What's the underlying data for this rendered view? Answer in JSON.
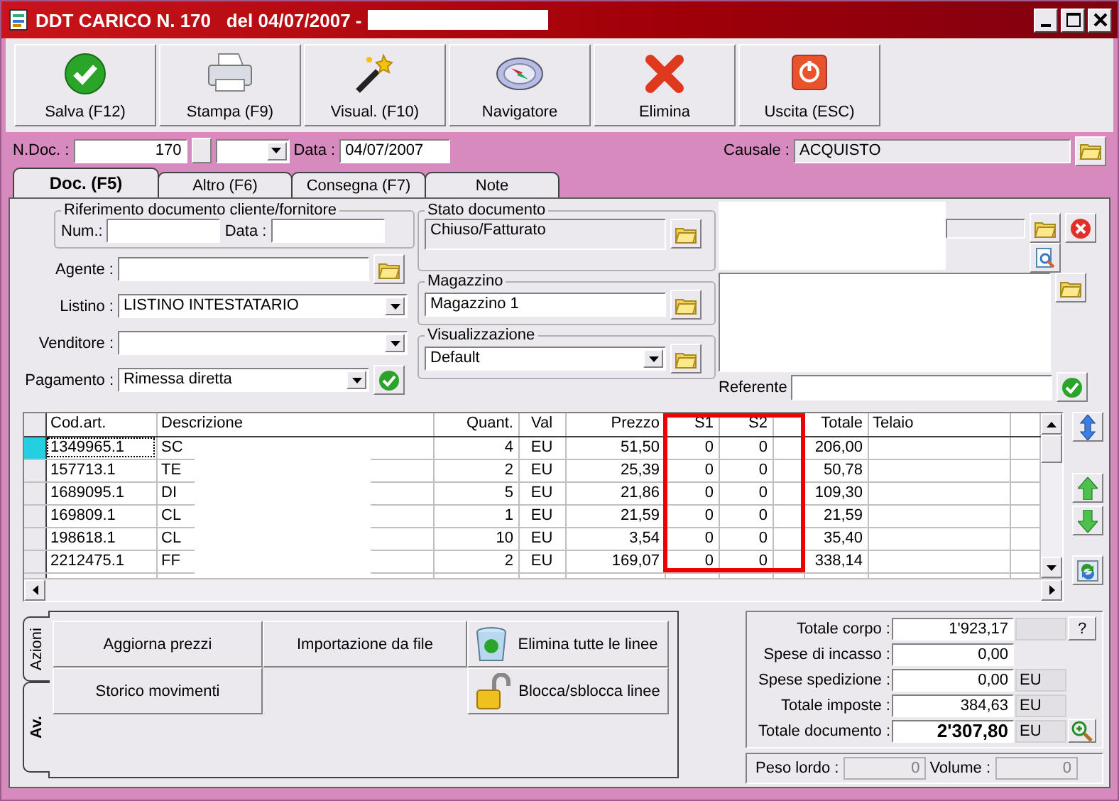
{
  "window": {
    "title": "DDT CARICO N. 170   del 04/07/2007 -"
  },
  "toolbar": [
    {
      "label": "Salva (F12)",
      "kind": "check"
    },
    {
      "label": "Stampa (F9)",
      "kind": "printer"
    },
    {
      "label": "Visual. (F10)",
      "kind": "wand"
    },
    {
      "label": "Navigatore",
      "kind": "compass"
    },
    {
      "label": "Elimina",
      "kind": "cross"
    },
    {
      "label": "Uscita (ESC)",
      "kind": "power"
    }
  ],
  "header": {
    "n_doc_label": "N.Doc. :",
    "n_doc": "170",
    "data_label": "Data :",
    "data": "04/07/2007",
    "causale_label": "Causale :",
    "causale": "ACQUISTO"
  },
  "tabs": [
    {
      "label": "Doc. (F5)",
      "selected": true
    },
    {
      "label": "Altro (F6)",
      "selected": false
    },
    {
      "label": "Consegna (F7)",
      "selected": false
    },
    {
      "label": "Note",
      "selected": false
    }
  ],
  "riferimento": {
    "legend": "Riferimento documento cliente/fornitore",
    "num_label": "Num.:",
    "data_label": "Data :"
  },
  "fields": [
    {
      "label": "Agente :",
      "kind": "lookup"
    },
    {
      "label": "Listino :",
      "kind": "select",
      "value": "LISTINO INTESTATARIO"
    },
    {
      "label": "Venditore :",
      "kind": "select"
    },
    {
      "label": "Pagamento :",
      "kind": "select-confirm",
      "value": "Rimessa diretta"
    }
  ],
  "stato": {
    "legend": "Stato documento",
    "value": "Chiuso/Fatturato"
  },
  "magazzino": {
    "legend": "Magazzino",
    "value": "Magazzino 1"
  },
  "visualizzazione": {
    "legend": "Visualizzazione",
    "value": "Default"
  },
  "referente": {
    "label": "Referente"
  },
  "table": {
    "columns": [
      {
        "label": "Cod.art.",
        "kind": "text",
        "highlighted": false
      },
      {
        "label": "Descrizione",
        "kind": "text",
        "highlighted": false
      },
      {
        "label": "Quant.",
        "kind": "number",
        "highlighted": false
      },
      {
        "label": "Val",
        "kind": "center",
        "highlighted": false
      },
      {
        "label": "Prezzo",
        "kind": "number",
        "highlighted": false
      },
      {
        "label": "S1",
        "kind": "number",
        "highlighted": true
      },
      {
        "label": "S2",
        "kind": "number",
        "highlighted": true
      },
      {
        "label": "Totale",
        "kind": "number",
        "highlighted": false
      },
      {
        "label": "Telaio",
        "kind": "text",
        "highlighted": false
      }
    ],
    "rows": [
      {
        "cells": [
          "1349965.1",
          "SC",
          "4",
          "EU",
          "51,50",
          "0",
          "0",
          "206,00"
        ],
        "selected": true
      },
      {
        "cells": [
          "157713.1",
          "TE",
          "2",
          "EU",
          "25,39",
          "0",
          "0",
          "50,78"
        ],
        "selected": false
      },
      {
        "cells": [
          "1689095.1",
          "DI",
          "5",
          "EU",
          "21,86",
          "0",
          "0",
          "109,30"
        ],
        "selected": false
      },
      {
        "cells": [
          "169809.1",
          "CL",
          "1",
          "EU",
          "21,59",
          "0",
          "0",
          "21,59"
        ],
        "selected": false
      },
      {
        "cells": [
          "198618.1",
          "CL",
          "10",
          "EU",
          "3,54",
          "0",
          "0",
          "35,40"
        ],
        "selected": false
      },
      {
        "cells": [
          "2212475.1",
          "FF",
          "2",
          "EU",
          "169,07",
          "0",
          "0",
          "338,14"
        ],
        "selected": false
      }
    ]
  },
  "actions": {
    "tabs": [
      {
        "label": "Azioni",
        "selected": false
      },
      {
        "label": "Av.",
        "selected": true
      }
    ],
    "buttons": [
      {
        "label": "Aggiorna prezzi",
        "kind": "plain"
      },
      {
        "label": "Importazione da file",
        "kind": "plain"
      },
      {
        "label": "Elimina tutte le linee",
        "kind": "trash"
      },
      {
        "label": "Storico movimenti",
        "kind": "plain"
      },
      {
        "label": "Blocca/sblocca linee",
        "kind": "lock"
      }
    ]
  },
  "totals": [
    {
      "label": "Totale corpo :",
      "value": "1'923,17",
      "kind": "help",
      "help": "?"
    },
    {
      "label": "Spese di incasso :",
      "value": "0,00",
      "kind": "plain"
    },
    {
      "label": "Spese spedizione :",
      "value": "0,00",
      "kind": "unit",
      "unit": "EU"
    },
    {
      "label": "Totale imposte :",
      "value": "384,63",
      "kind": "unit",
      "unit": "EU"
    },
    {
      "label": "Totale documento :",
      "value": "2'307,80",
      "kind": "grand",
      "unit": "EU"
    }
  ],
  "weights": {
    "peso_label": "Peso lordo :",
    "peso": "0",
    "volume_label": "Volume :",
    "volume": "0"
  }
}
